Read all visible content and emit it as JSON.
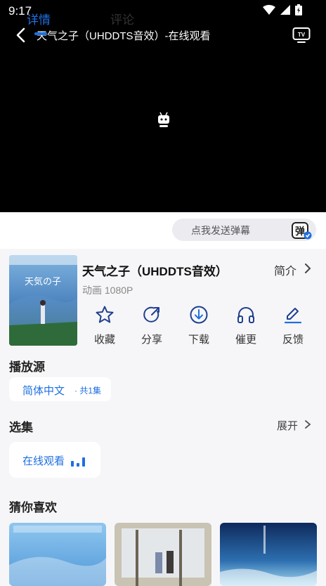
{
  "status_bar": {
    "time": "9:17"
  },
  "player": {
    "title": "天气之子（UHDDTS音效）-在线观看"
  },
  "tabs": [
    {
      "label": "详情"
    },
    {
      "label": "评论"
    }
  ],
  "danmaku": {
    "placeholder": "点我发送弹幕",
    "button_glyph": "弹"
  },
  "movie": {
    "title": "天气之子（UHDDTS音效）",
    "intro_label": "简介",
    "meta": "动画 1080P"
  },
  "actions": [
    {
      "label": "收藏",
      "icon": "star-icon"
    },
    {
      "label": "分享",
      "icon": "share-icon"
    },
    {
      "label": "下载",
      "icon": "download-icon"
    },
    {
      "label": "催更",
      "icon": "headphones-icon"
    },
    {
      "label": "反馈",
      "icon": "edit-icon"
    }
  ],
  "source": {
    "heading": "播放源",
    "chip_label": "简体中文",
    "chip_count": "· 共1集"
  },
  "episodes": {
    "heading": "选集",
    "expand_label": "展开",
    "items": [
      {
        "label": "在线观看"
      }
    ]
  },
  "recommend": {
    "heading": "猜你喜欢"
  },
  "colors": {
    "accent": "#1f6fe0",
    "background": "#f6f6f8",
    "player_bg": "#000000"
  }
}
